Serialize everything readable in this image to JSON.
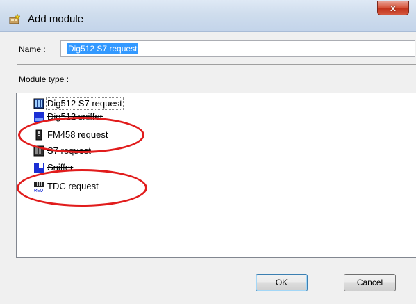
{
  "window": {
    "title": "Add module",
    "close_glyph": "x"
  },
  "name": {
    "label": "Name :",
    "value": "Dig512 S7 request"
  },
  "module_type": {
    "label": "Module type :",
    "items": [
      {
        "label": "Dig512 S7 request",
        "icon": "dig512-s7-icon"
      },
      {
        "label": "Dig512 sniffer",
        "icon": "dig512-sniffer-icon"
      },
      {
        "label": "FM458 request",
        "icon": "fm458-icon"
      },
      {
        "label": "S7 request",
        "icon": "s7-request-icon"
      },
      {
        "label": "Sniffer",
        "icon": "sniffer-icon"
      },
      {
        "label": "TDC request",
        "icon": "tdc-request-icon"
      }
    ]
  },
  "buttons": {
    "ok": "OK",
    "cancel": "Cancel"
  },
  "colors": {
    "annotation": "#e11c1c",
    "selection": "#3399ff"
  }
}
